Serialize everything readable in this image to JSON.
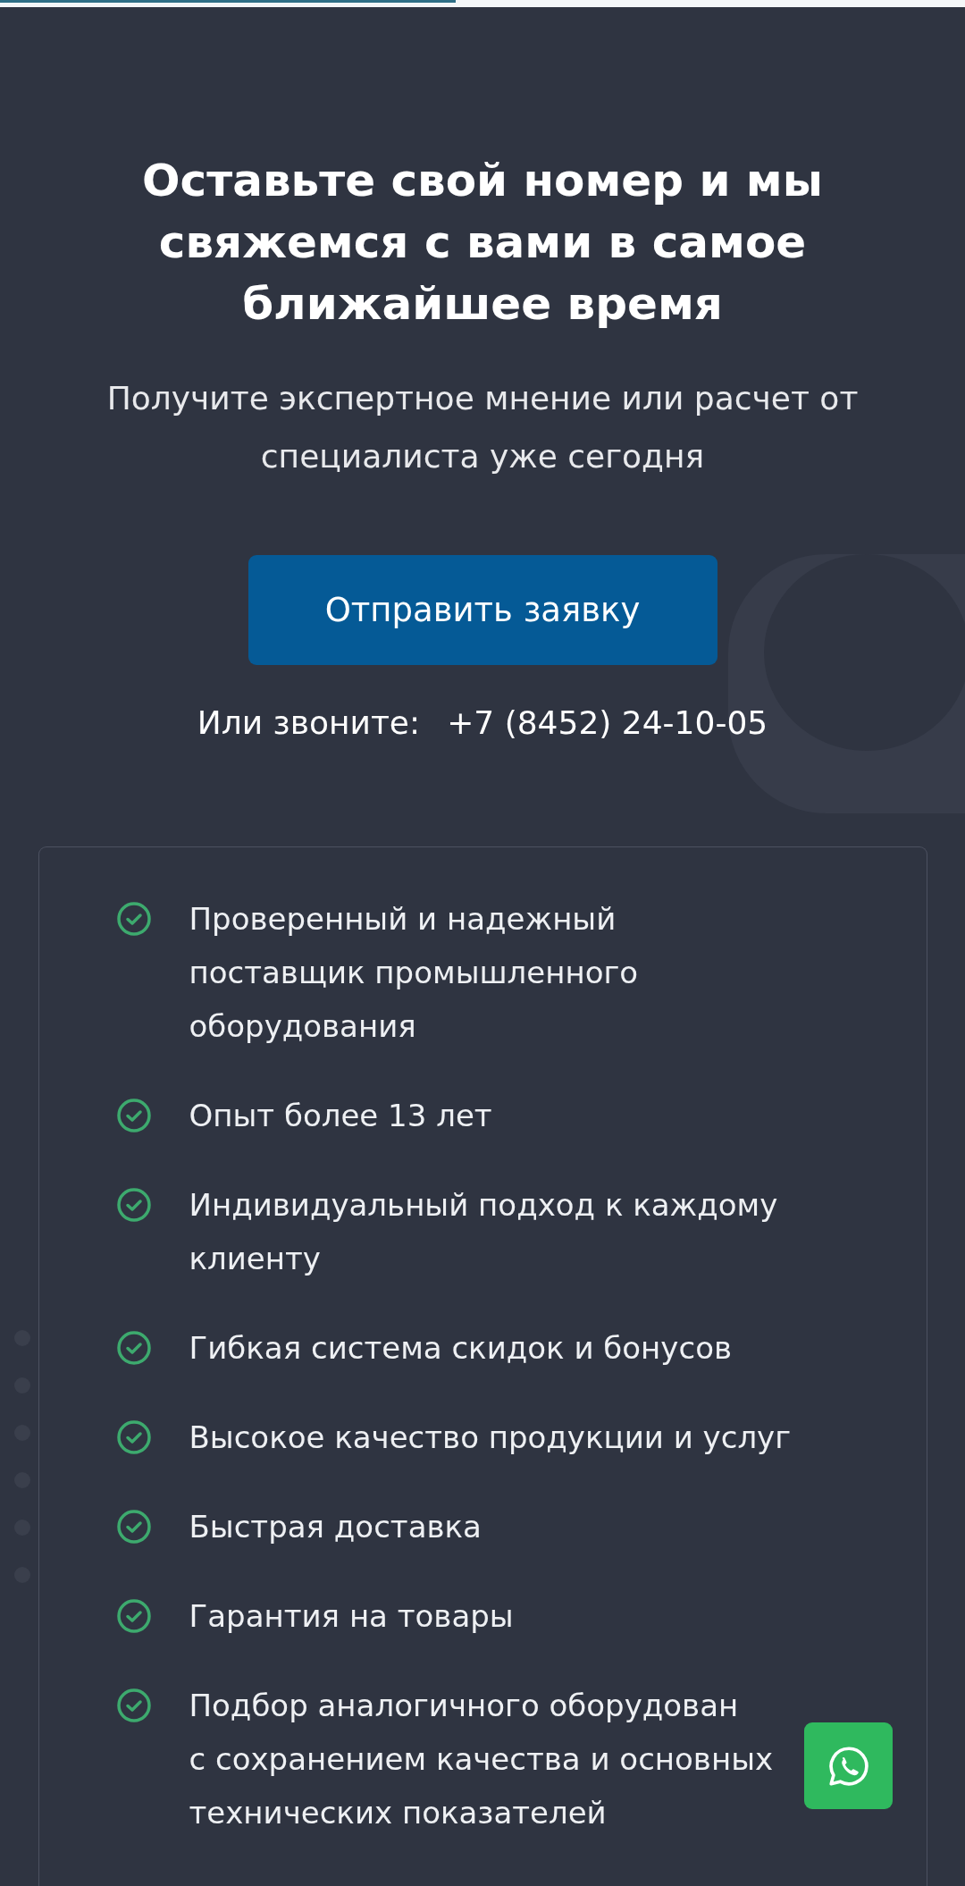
{
  "heading": "Оставьте свой номер и мы свяжемся с вами в самое ближайшее время",
  "subtitle": "Получите экспертное мнение или расчет от специалиста уже сегодня",
  "submit_button": "Отправить заявку",
  "call": {
    "label": "Или звоните:",
    "phone": "+7 (8452) 24-10-05"
  },
  "benefits": [
    {
      "lines": [
        "Проверенный и надежный",
        "поставщик промышленного",
        "оборудования"
      ]
    },
    {
      "lines": [
        "Опыт более 13 лет"
      ]
    },
    {
      "lines": [
        "Индивидуальный подход к каждому",
        "клиенту"
      ]
    },
    {
      "lines": [
        "Гибкая система скидок и бонусов"
      ]
    },
    {
      "lines": [
        "Высокое качество продукции и услуг"
      ]
    },
    {
      "lines": [
        "Быстрая доставка"
      ]
    },
    {
      "lines": [
        "Гарантия на товары"
      ]
    },
    {
      "lines": [
        "Подбор аналогичного оборудован",
        "с сохранением качества и основных",
        "технических показателей"
      ]
    }
  ]
}
